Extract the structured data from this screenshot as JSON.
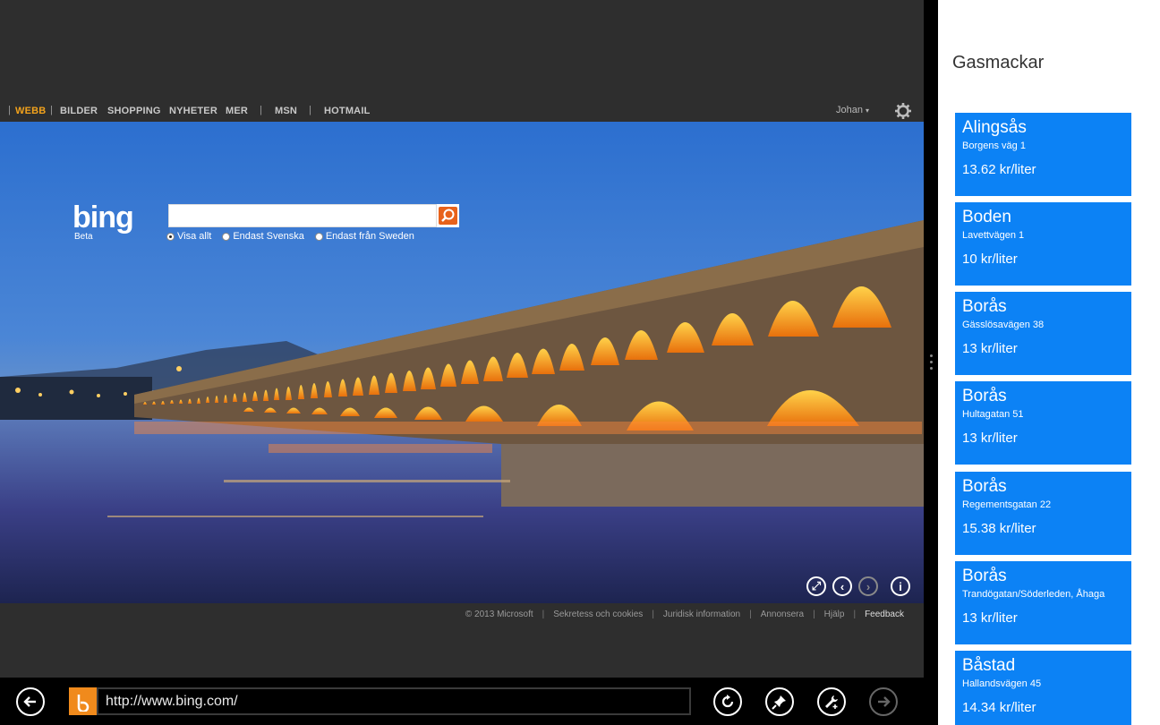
{
  "nav": {
    "items": [
      "WEBB",
      "BILDER",
      "SHOPPING",
      "NYHETER",
      "MER",
      "MSN",
      "HOTMAIL"
    ],
    "active": "WEBB",
    "user": "Johan"
  },
  "search": {
    "logo": "bing",
    "beta": "Beta",
    "query": "",
    "scopes": [
      "Visa allt",
      "Endast Svenska",
      "Endast från Sweden"
    ],
    "selected_scope": "Visa allt"
  },
  "footer": {
    "links": [
      "© 2013 Microsoft",
      "Sekretess och cookies",
      "Juridisk information",
      "Annonsera",
      "Hjälp",
      "Feedback"
    ]
  },
  "appbar": {
    "url": "http://www.bing.com/",
    "icons": [
      "back-icon",
      "refresh-icon",
      "pin-icon",
      "tools-icon",
      "forward-icon"
    ]
  },
  "snap": {
    "title": "Gasmackar",
    "stations": [
      {
        "city": "Alingsås",
        "street": "Borgens väg 1",
        "price": "13.62 kr/liter"
      },
      {
        "city": "Boden",
        "street": "Lavettvägen 1",
        "price": "10 kr/liter"
      },
      {
        "city": "Borås",
        "street": "Gässlösavägen 38",
        "price": "13 kr/liter"
      },
      {
        "city": "Borås",
        "street": "Hultagatan 51",
        "price": "13 kr/liter"
      },
      {
        "city": "Borås",
        "street": "Regementsgatan 22",
        "price": "15.38 kr/liter"
      },
      {
        "city": "Borås",
        "street": "Trandögatan/Söderleden, Åhaga",
        "price": "13 kr/liter"
      },
      {
        "city": "Båstad",
        "street": "Hallandsvägen 45",
        "price": "14.34 kr/liter"
      }
    ]
  },
  "colors": {
    "accent": "#f2a21c",
    "tile": "#0c82f5",
    "chrome": "#2e2e2e"
  }
}
